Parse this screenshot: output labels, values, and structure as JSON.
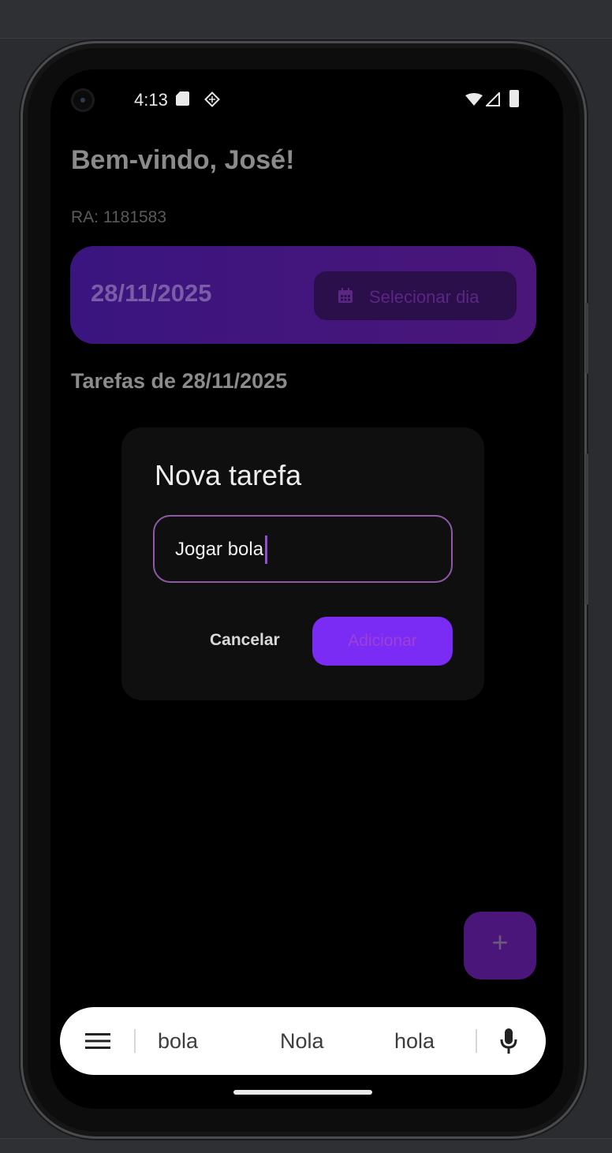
{
  "status_bar": {
    "time": "4:13",
    "icons": [
      "sd-card-icon",
      "diamond-notification-icon",
      "wifi-icon",
      "signal-icon",
      "battery-icon"
    ]
  },
  "header": {
    "welcome": "Bem-vindo, José!",
    "ra": "RA: 1181583"
  },
  "date_card": {
    "date": "28/11/2025",
    "select_day_label": "Selecionar dia",
    "select_day_icon": "calendar-icon"
  },
  "tasks": {
    "title": "Tarefas de 28/11/2025"
  },
  "dialog": {
    "title": "Nova tarefa",
    "input_value": "Jogar bola",
    "cancel_label": "Cancelar",
    "add_label": "Adicionar"
  },
  "fab": {
    "label": "+",
    "icon": "plus-icon"
  },
  "keyboard": {
    "suggestions": [
      "bola",
      "Nola",
      "hola"
    ],
    "menu_icon": "menu-icon",
    "mic_icon": "mic-icon"
  },
  "colors": {
    "accent": "#7a2cf5",
    "card": "#3a157f",
    "input_border": "#8e5aa8"
  }
}
